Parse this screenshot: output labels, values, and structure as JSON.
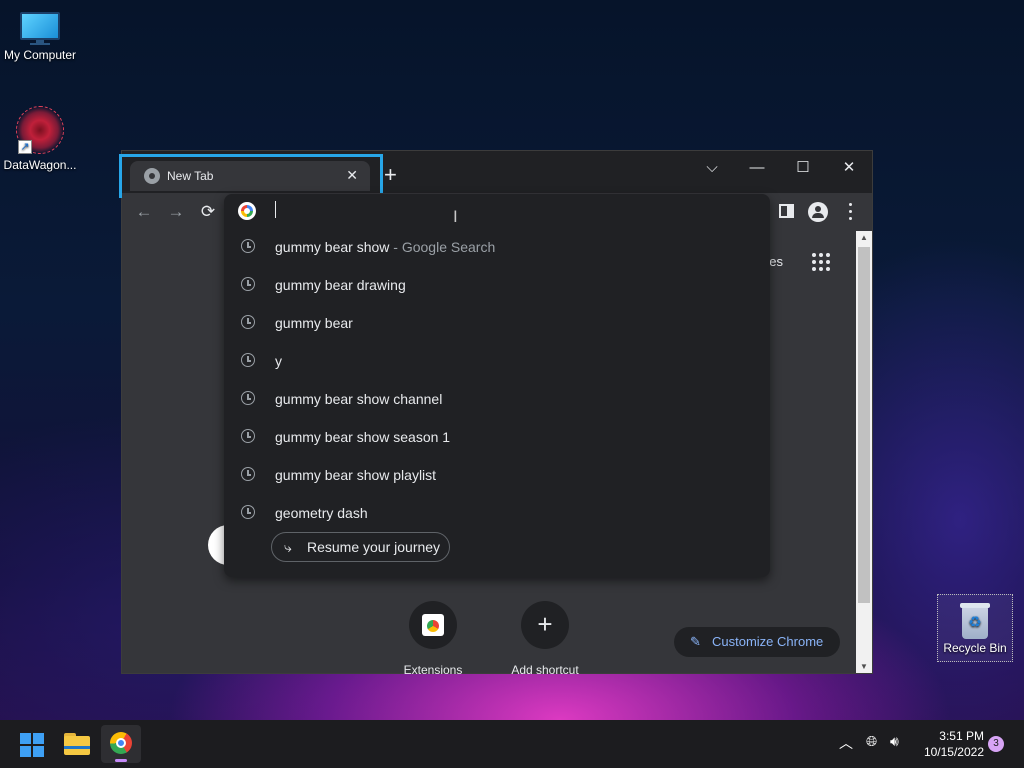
{
  "desktop": {
    "icons": [
      {
        "label": "My Computer",
        "icon": "monitor-icon"
      },
      {
        "label": "DataWagon...",
        "icon": "datawagon-icon"
      }
    ],
    "recycle_bin": {
      "label": "Recycle Bin",
      "icon": "recycle-bin-icon"
    }
  },
  "browser": {
    "tab": {
      "title": "New Tab",
      "close_glyph": "✕",
      "favicon": "chrome-favicon-icon"
    },
    "new_tab_glyph": "+",
    "window_controls": {
      "dropdown": "⌵",
      "minimize": "—",
      "maximize": "☐",
      "close": "✕"
    },
    "toolbar": {
      "back": "←",
      "forward": "→",
      "reload": "⟳"
    },
    "omnibox": {
      "value": "",
      "suggestions": [
        {
          "text": "gummy bear show",
          "desc": " - Google Search"
        },
        {
          "text": "gummy bear drawing",
          "desc": ""
        },
        {
          "text": "gummy bear",
          "desc": ""
        },
        {
          "text": "y",
          "desc": ""
        },
        {
          "text": "gummy bear show channel",
          "desc": ""
        },
        {
          "text": "gummy bear show season 1",
          "desc": ""
        },
        {
          "text": "gummy bear show playlist",
          "desc": ""
        },
        {
          "text": "geometry dash",
          "desc": ""
        }
      ],
      "resume_chip": "Resume your journey"
    },
    "ntp": {
      "images_link": "ges",
      "shortcuts": [
        {
          "label": "Extensions",
          "icon": "extensions-icon"
        },
        {
          "label": "Add shortcut",
          "icon": "plus-icon"
        }
      ],
      "customize_label": "Customize Chrome"
    }
  },
  "taskbar": {
    "time": "3:51 PM",
    "date": "10/15/2022",
    "notification_count": "3",
    "chevron": "︿",
    "accent": "#3ea0f5"
  },
  "colors": {
    "highlight_border": "#27a6e8",
    "chrome_dark_bg": "#202124",
    "chrome_toolbar": "#35363a",
    "link_blue": "#8ab4f8"
  }
}
